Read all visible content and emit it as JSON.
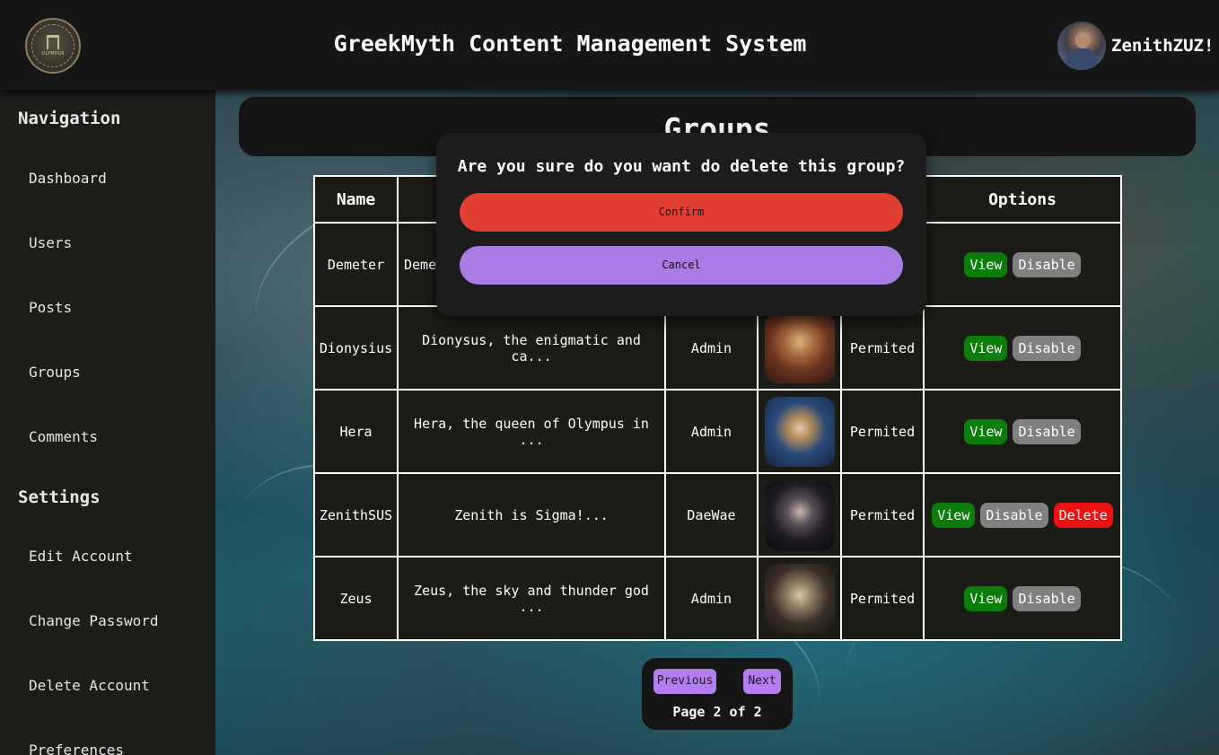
{
  "header": {
    "title": "GreekMyth Content Management System",
    "logo_text": "OLYMPUS",
    "username": "ZenithZUZ!"
  },
  "sidebar": {
    "navigation_title": "Navigation",
    "navigation_items": [
      "Dashboard",
      "Users",
      "Posts",
      "Groups",
      "Comments"
    ],
    "settings_title": "Settings",
    "settings_items": [
      "Edit Account",
      "Change Password",
      "Delete Account",
      "Preferences"
    ]
  },
  "page": {
    "title": "Groups"
  },
  "table": {
    "headers": {
      "name": "Name",
      "options": "Options"
    },
    "rows": [
      {
        "name": "Demeter",
        "description": "Demet",
        "owner": "",
        "status": "",
        "has_delete": false
      },
      {
        "name": "Dionysius",
        "description": "Dionysus, the enigmatic and ca...",
        "owner": "Admin",
        "status": "Permited",
        "has_delete": false
      },
      {
        "name": "Hera",
        "description": "Hera, the queen of Olympus in ...",
        "owner": "Admin",
        "status": "Permited",
        "has_delete": false
      },
      {
        "name": "ZenithSUS",
        "description": "Zenith is Sigma!...",
        "owner": "DaeWae",
        "status": "Permited",
        "has_delete": true
      },
      {
        "name": "Zeus",
        "description": "Zeus, the sky and thunder god ...",
        "owner": "Admin",
        "status": "Permited",
        "has_delete": false
      }
    ],
    "buttons": {
      "view": "View",
      "disable": "Disable",
      "delete": "Delete"
    }
  },
  "pagination": {
    "previous": "Previous",
    "next": "Next",
    "label": "Page 2 of 2"
  },
  "modal": {
    "question": "Are you sure do you want do delete this group?",
    "confirm": "Confirm",
    "cancel": "Cancel"
  },
  "colors": {
    "view_button": "#0b7d0b",
    "disable_button": "#808080",
    "delete_button": "#ee1111",
    "confirm_button": "#e23e33",
    "cancel_button": "#a87be6",
    "pager_button": "#b27ef0"
  }
}
